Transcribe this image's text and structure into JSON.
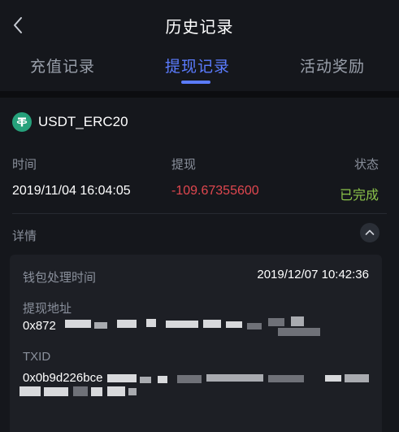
{
  "header": {
    "title": "历史记录",
    "back_icon": "chevron-left-icon"
  },
  "tabs": [
    {
      "label": "充值记录",
      "active": false
    },
    {
      "label": "提现记录",
      "active": true
    },
    {
      "label": "活动奖励",
      "active": false
    }
  ],
  "colors": {
    "accent": "#5b7cff",
    "negative": "#e0474f",
    "success": "#8bc34a",
    "coin": "#26a17b"
  },
  "record": {
    "coin": {
      "name": "USDT_ERC20",
      "icon": "tether-icon"
    },
    "columns": {
      "time": "时间",
      "amount": "提现",
      "status": "状态"
    },
    "time": "2019/11/04 16:04:05",
    "amount": "-109.67355600",
    "status": "已完成",
    "details_label": "详情",
    "details": {
      "wallet_time_label": "钱包处理时间",
      "wallet_time": "2019/12/07 10:42:36",
      "address_label": "提现地址",
      "address_visible": "0x872",
      "txid_label": "TXID",
      "txid_visible": "0x0b9d226bce"
    }
  }
}
